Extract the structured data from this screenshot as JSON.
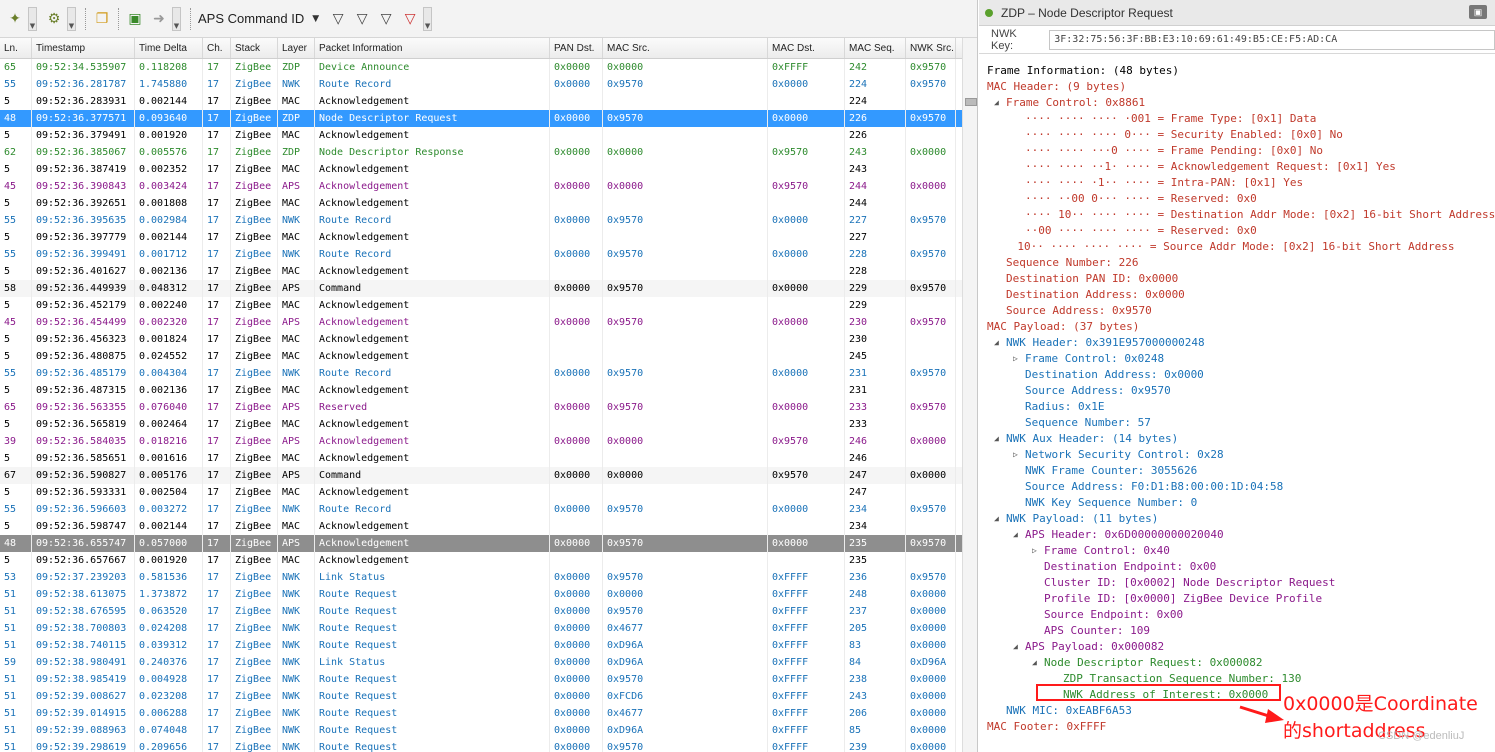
{
  "toolbar": {
    "capture_label": "APS Command ID"
  },
  "columns": [
    "Ln.",
    "Timestamp",
    "Time Delta",
    "Ch.",
    "Stack",
    "Layer",
    "Packet Information",
    "PAN Dst.",
    "MAC Src.",
    "MAC Dst.",
    "MAC Seq.",
    "NWK Src."
  ],
  "colors": {
    "green": "#2e8b2e",
    "blue": "#1a72b8",
    "purple": "#8b1a8b",
    "black": "#000000",
    "red": "#c0392b",
    "navy": "#20508c",
    "select": "#3399ff"
  },
  "rows": [
    [
      "65",
      "09:52:34.535907",
      "0.118208",
      "17",
      "ZigBee",
      "ZDP",
      "Device Announce",
      "0x0000",
      "0x0000",
      "0xFFFF",
      "242",
      "0x9570",
      "green",
      ""
    ],
    [
      "55",
      "09:52:36.281787",
      "1.745880",
      "17",
      "ZigBee",
      "NWK",
      "Route Record",
      "0x0000",
      "0x9570",
      "0x0000",
      "224",
      "0x9570",
      "blue",
      ""
    ],
    [
      "5",
      "09:52:36.283931",
      "0.002144",
      "17",
      "ZigBee",
      "MAC",
      "Acknowledgement",
      "",
      "",
      "",
      "224",
      "",
      "black",
      ""
    ],
    [
      "48",
      "09:52:36.377571",
      "0.093640",
      "17",
      "ZigBee",
      "ZDP",
      "Node Descriptor Request",
      "0x0000",
      "0x9570",
      "0x0000",
      "226",
      "0x9570",
      "green",
      "sel"
    ],
    [
      "5",
      "09:52:36.379491",
      "0.001920",
      "17",
      "ZigBee",
      "MAC",
      "Acknowledgement",
      "",
      "",
      "",
      "226",
      "",
      "black",
      ""
    ],
    [
      "62",
      "09:52:36.385067",
      "0.005576",
      "17",
      "ZigBee",
      "ZDP",
      "Node Descriptor Response",
      "0x0000",
      "0x0000",
      "0x9570",
      "243",
      "0x0000",
      "green",
      ""
    ],
    [
      "5",
      "09:52:36.387419",
      "0.002352",
      "17",
      "ZigBee",
      "MAC",
      "Acknowledgement",
      "",
      "",
      "",
      "243",
      "",
      "black",
      ""
    ],
    [
      "45",
      "09:52:36.390843",
      "0.003424",
      "17",
      "ZigBee",
      "APS",
      "Acknowledgement",
      "0x0000",
      "0x0000",
      "0x9570",
      "244",
      "0x0000",
      "purple",
      ""
    ],
    [
      "5",
      "09:52:36.392651",
      "0.001808",
      "17",
      "ZigBee",
      "MAC",
      "Acknowledgement",
      "",
      "",
      "",
      "244",
      "",
      "black",
      ""
    ],
    [
      "55",
      "09:52:36.395635",
      "0.002984",
      "17",
      "ZigBee",
      "NWK",
      "Route Record",
      "0x0000",
      "0x9570",
      "0x0000",
      "227",
      "0x9570",
      "blue",
      ""
    ],
    [
      "5",
      "09:52:36.397779",
      "0.002144",
      "17",
      "ZigBee",
      "MAC",
      "Acknowledgement",
      "",
      "",
      "",
      "227",
      "",
      "black",
      ""
    ],
    [
      "55",
      "09:52:36.399491",
      "0.001712",
      "17",
      "ZigBee",
      "NWK",
      "Route Record",
      "0x0000",
      "0x9570",
      "0x0000",
      "228",
      "0x9570",
      "blue",
      ""
    ],
    [
      "5",
      "09:52:36.401627",
      "0.002136",
      "17",
      "ZigBee",
      "MAC",
      "Acknowledgement",
      "",
      "",
      "",
      "228",
      "",
      "black",
      ""
    ],
    [
      "58",
      "09:52:36.449939",
      "0.048312",
      "17",
      "ZigBee",
      "APS",
      "Command",
      "0x0000",
      "0x9570",
      "0x0000",
      "229",
      "0x9570",
      "black",
      "alt"
    ],
    [
      "5",
      "09:52:36.452179",
      "0.002240",
      "17",
      "ZigBee",
      "MAC",
      "Acknowledgement",
      "",
      "",
      "",
      "229",
      "",
      "black",
      ""
    ],
    [
      "45",
      "09:52:36.454499",
      "0.002320",
      "17",
      "ZigBee",
      "APS",
      "Acknowledgement",
      "0x0000",
      "0x9570",
      "0x0000",
      "230",
      "0x9570",
      "purple",
      ""
    ],
    [
      "5",
      "09:52:36.456323",
      "0.001824",
      "17",
      "ZigBee",
      "MAC",
      "Acknowledgement",
      "",
      "",
      "",
      "230",
      "",
      "black",
      ""
    ],
    [
      "5",
      "09:52:36.480875",
      "0.024552",
      "17",
      "ZigBee",
      "MAC",
      "Acknowledgement",
      "",
      "",
      "",
      "245",
      "",
      "black",
      ""
    ],
    [
      "55",
      "09:52:36.485179",
      "0.004304",
      "17",
      "ZigBee",
      "NWK",
      "Route Record",
      "0x0000",
      "0x9570",
      "0x0000",
      "231",
      "0x9570",
      "blue",
      ""
    ],
    [
      "5",
      "09:52:36.487315",
      "0.002136",
      "17",
      "ZigBee",
      "MAC",
      "Acknowledgement",
      "",
      "",
      "",
      "231",
      "",
      "black",
      ""
    ],
    [
      "65",
      "09:52:36.563355",
      "0.076040",
      "17",
      "ZigBee",
      "APS",
      "Reserved",
      "0x0000",
      "0x9570",
      "0x0000",
      "233",
      "0x9570",
      "purple",
      ""
    ],
    [
      "5",
      "09:52:36.565819",
      "0.002464",
      "17",
      "ZigBee",
      "MAC",
      "Acknowledgement",
      "",
      "",
      "",
      "233",
      "",
      "black",
      ""
    ],
    [
      "39",
      "09:52:36.584035",
      "0.018216",
      "17",
      "ZigBee",
      "APS",
      "Acknowledgement",
      "0x0000",
      "0x0000",
      "0x9570",
      "246",
      "0x0000",
      "purple",
      ""
    ],
    [
      "5",
      "09:52:36.585651",
      "0.001616",
      "17",
      "ZigBee",
      "MAC",
      "Acknowledgement",
      "",
      "",
      "",
      "246",
      "",
      "black",
      ""
    ],
    [
      "67",
      "09:52:36.590827",
      "0.005176",
      "17",
      "ZigBee",
      "APS",
      "Command",
      "0x0000",
      "0x0000",
      "0x9570",
      "247",
      "0x0000",
      "black",
      "alt"
    ],
    [
      "5",
      "09:52:36.593331",
      "0.002504",
      "17",
      "ZigBee",
      "MAC",
      "Acknowledgement",
      "",
      "",
      "",
      "247",
      "",
      "black",
      ""
    ],
    [
      "55",
      "09:52:36.596603",
      "0.003272",
      "17",
      "ZigBee",
      "NWK",
      "Route Record",
      "0x0000",
      "0x9570",
      "0x0000",
      "234",
      "0x9570",
      "blue",
      ""
    ],
    [
      "5",
      "09:52:36.598747",
      "0.002144",
      "17",
      "ZigBee",
      "MAC",
      "Acknowledgement",
      "",
      "",
      "",
      "234",
      "",
      "black",
      ""
    ],
    [
      "48",
      "09:52:36.655747",
      "0.057000",
      "17",
      "ZigBee",
      "APS",
      "Acknowledgement",
      "0x0000",
      "0x9570",
      "0x0000",
      "235",
      "0x9570",
      "purple",
      "sel2"
    ],
    [
      "5",
      "09:52:36.657667",
      "0.001920",
      "17",
      "ZigBee",
      "MAC",
      "Acknowledgement",
      "",
      "",
      "",
      "235",
      "",
      "black",
      ""
    ],
    [
      "53",
      "09:52:37.239203",
      "0.581536",
      "17",
      "ZigBee",
      "NWK",
      "Link Status",
      "0x0000",
      "0x9570",
      "0xFFFF",
      "236",
      "0x9570",
      "blue",
      ""
    ],
    [
      "51",
      "09:52:38.613075",
      "1.373872",
      "17",
      "ZigBee",
      "NWK",
      "Route Request",
      "0x0000",
      "0x0000",
      "0xFFFF",
      "248",
      "0x0000",
      "blue",
      ""
    ],
    [
      "51",
      "09:52:38.676595",
      "0.063520",
      "17",
      "ZigBee",
      "NWK",
      "Route Request",
      "0x0000",
      "0x9570",
      "0xFFFF",
      "237",
      "0x0000",
      "blue",
      ""
    ],
    [
      "51",
      "09:52:38.700803",
      "0.024208",
      "17",
      "ZigBee",
      "NWK",
      "Route Request",
      "0x0000",
      "0x4677",
      "0xFFFF",
      "205",
      "0x0000",
      "blue",
      ""
    ],
    [
      "51",
      "09:52:38.740115",
      "0.039312",
      "17",
      "ZigBee",
      "NWK",
      "Route Request",
      "0x0000",
      "0xD96A",
      "0xFFFF",
      "83",
      "0x0000",
      "blue",
      ""
    ],
    [
      "59",
      "09:52:38.980491",
      "0.240376",
      "17",
      "ZigBee",
      "NWK",
      "Link Status",
      "0x0000",
      "0xD96A",
      "0xFFFF",
      "84",
      "0xD96A",
      "blue",
      ""
    ],
    [
      "51",
      "09:52:38.985419",
      "0.004928",
      "17",
      "ZigBee",
      "NWK",
      "Route Request",
      "0x0000",
      "0x9570",
      "0xFFFF",
      "238",
      "0x0000",
      "blue",
      ""
    ],
    [
      "51",
      "09:52:39.008627",
      "0.023208",
      "17",
      "ZigBee",
      "NWK",
      "Route Request",
      "0x0000",
      "0xFCD6",
      "0xFFFF",
      "243",
      "0x0000",
      "blue",
      ""
    ],
    [
      "51",
      "09:52:39.014915",
      "0.006288",
      "17",
      "ZigBee",
      "NWK",
      "Route Request",
      "0x0000",
      "0x4677",
      "0xFFFF",
      "206",
      "0x0000",
      "blue",
      ""
    ],
    [
      "51",
      "09:52:39.088963",
      "0.074048",
      "17",
      "ZigBee",
      "NWK",
      "Route Request",
      "0x0000",
      "0xD96A",
      "0xFFFF",
      "85",
      "0x0000",
      "blue",
      ""
    ],
    [
      "51",
      "09:52:39.298619",
      "0.209656",
      "17",
      "ZigBee",
      "NWK",
      "Route Request",
      "0x0000",
      "0x9570",
      "0xFFFF",
      "239",
      "0x0000",
      "blue",
      ""
    ]
  ],
  "detail": {
    "title": "ZDP – Node Descriptor Request",
    "key_label": "NWK Key:",
    "key_value": "3F:32:75:56:3F:BB:E3:10:69:61:49:B5:CE:F5:AD:CA",
    "lines": [
      [
        "0",
        "Frame Information: (48 bytes)",
        "black",
        ""
      ],
      [
        "0",
        "MAC Header: (9 bytes)",
        "red",
        ""
      ],
      [
        "1",
        "Frame Control: 0x8861",
        "red",
        "open"
      ],
      [
        "2",
        "···· ···· ···· ·001 = Frame Type: [0x1] Data",
        "red",
        ""
      ],
      [
        "2",
        "···· ···· ···· 0··· = Security Enabled: [0x0] No",
        "red",
        ""
      ],
      [
        "2",
        "···· ···· ···0 ···· = Frame Pending: [0x0] No",
        "red",
        ""
      ],
      [
        "2",
        "···· ···· ··1· ···· = Acknowledgement Request: [0x1] Yes",
        "red",
        ""
      ],
      [
        "2",
        "···· ···· ·1·· ···· = Intra-PAN: [0x1] Yes",
        "red",
        ""
      ],
      [
        "2",
        "···· ··00 0··· ···· = Reserved: 0x0",
        "red",
        ""
      ],
      [
        "2",
        "···· 10·· ···· ···· = Destination Addr Mode: [0x2] 16-bit Short Address",
        "red",
        ""
      ],
      [
        "2",
        "··00 ···· ···· ···· = Reserved: 0x0",
        "red",
        ""
      ],
      [
        "1.6",
        "10·· ···· ···· ···· = Source Addr Mode: [0x2] 16-bit Short Address",
        "red",
        ""
      ],
      [
        "1",
        "Sequence Number: 226",
        "red",
        ""
      ],
      [
        "1",
        "Destination PAN ID: 0x0000",
        "red",
        ""
      ],
      [
        "1",
        "Destination Address: 0x0000",
        "red",
        ""
      ],
      [
        "1",
        "Source Address: 0x9570",
        "red",
        ""
      ],
      [
        "0",
        "MAC Payload: (37 bytes)",
        "red",
        ""
      ],
      [
        "1",
        "NWK Header: 0x391E957000000248",
        "blue",
        "open"
      ],
      [
        "2",
        "Frame Control: 0x0248",
        "blue",
        "closed"
      ],
      [
        "2",
        "Destination Address: 0x0000",
        "blue",
        ""
      ],
      [
        "2",
        "Source Address: 0x9570",
        "blue",
        ""
      ],
      [
        "2",
        "Radius: 0x1E",
        "blue",
        ""
      ],
      [
        "2",
        "Sequence Number: 57",
        "blue",
        ""
      ],
      [
        "1",
        "NWK Aux Header: (14 bytes)",
        "blue",
        "open"
      ],
      [
        "2",
        "Network Security Control: 0x28",
        "blue",
        "closed"
      ],
      [
        "2",
        "NWK Frame Counter: 3055626",
        "blue",
        ""
      ],
      [
        "2",
        "Source Address: F0:D1:B8:00:00:1D:04:58",
        "blue",
        ""
      ],
      [
        "2",
        "NWK Key Sequence Number: 0",
        "blue",
        ""
      ],
      [
        "1",
        "NWK Payload: (11 bytes)",
        "blue",
        "open"
      ],
      [
        "2",
        "APS Header: 0x6D00000000020040",
        "purple",
        "open"
      ],
      [
        "3",
        "Frame Control: 0x40",
        "purple",
        "closed"
      ],
      [
        "3",
        "Destination Endpoint: 0x00",
        "purple",
        ""
      ],
      [
        "3",
        "Cluster ID: [0x0002] Node Descriptor Request",
        "purple",
        ""
      ],
      [
        "3",
        "Profile ID: [0x0000] ZigBee Device Profile",
        "purple",
        ""
      ],
      [
        "3",
        "Source Endpoint: 0x00",
        "purple",
        ""
      ],
      [
        "3",
        "APS Counter: 109",
        "purple",
        ""
      ],
      [
        "2",
        "APS Payload: 0x000082",
        "purple",
        "open"
      ],
      [
        "3",
        "Node Descriptor Request: 0x000082",
        "green",
        "open"
      ],
      [
        "4",
        "ZDP Transaction Sequence Number: 130",
        "green",
        ""
      ],
      [
        "4",
        "NWK Address of Interest: 0x0000",
        "green",
        ""
      ],
      [
        "1",
        "NWK MIC: 0xEABF6A53",
        "blue",
        ""
      ],
      [
        "0",
        "MAC Footer: 0xFFFF",
        "red",
        ""
      ]
    ]
  },
  "annotation": {
    "line1": "0x0000是Coordinate",
    "line2": "的shortaddress"
  },
  "watermark": "CSDN @edenliuJ"
}
